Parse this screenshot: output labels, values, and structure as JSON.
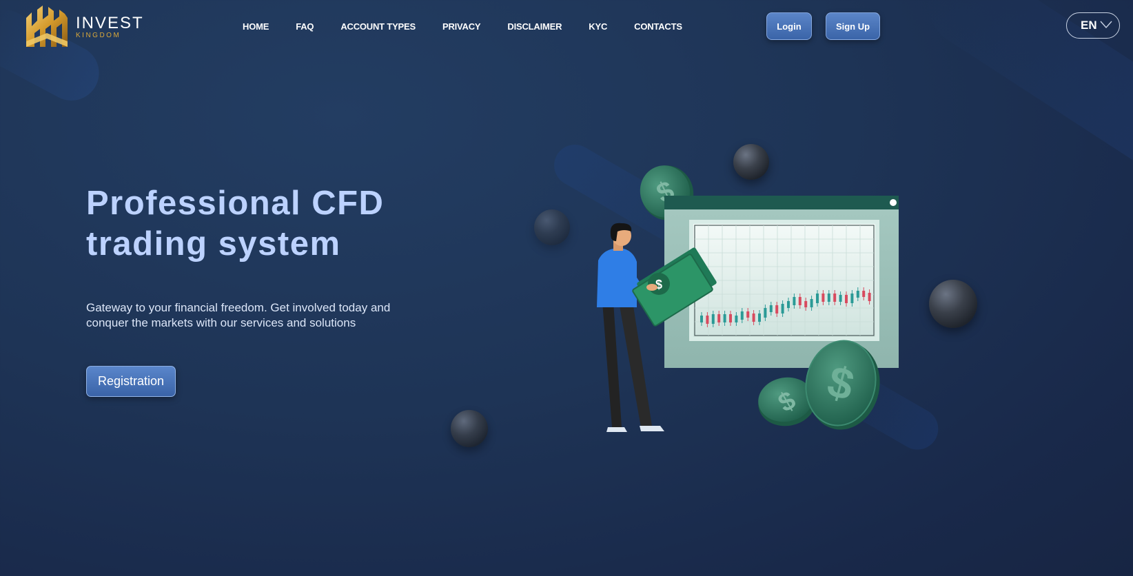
{
  "brand": {
    "name": "INVEST",
    "subname": "KINGDOM",
    "accent_color": "#d9a83a"
  },
  "nav": {
    "items": [
      "HOME",
      "FAQ",
      "ACCOUNT TYPES",
      "PRIVACY",
      "DISCLAIMER",
      "KYC",
      "CONTACTS"
    ]
  },
  "header": {
    "login_label": "Login",
    "signup_label": "Sign Up",
    "language": "EN"
  },
  "hero": {
    "title_line1": "Professional CFD",
    "title_line2": "trading system",
    "subtitle_line1": "Gateway to your financial freedom. Get involved today and",
    "subtitle_line2": "conquer the markets with our services and solutions",
    "cta_label": "Registration",
    "title_color": "#bcd2ff"
  },
  "illustration": {
    "dollar_glyph": "$"
  }
}
